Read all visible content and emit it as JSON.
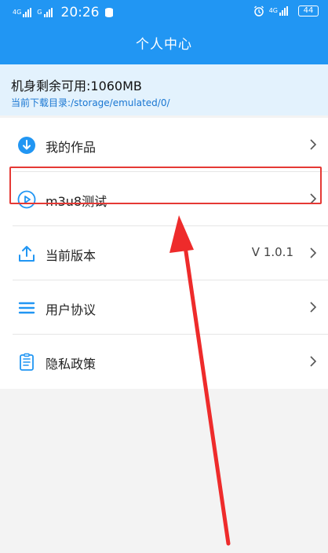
{
  "status_bar": {
    "signal1_label": "4G",
    "signal2_label": "G",
    "time": "20:26",
    "right_network": "4G",
    "battery": "44"
  },
  "header": {
    "title": "个人中心"
  },
  "storage": {
    "free_space": "机身剩余可用:1060MB",
    "download_path": "当前下载目录:/storage/emulated/0/"
  },
  "menu": {
    "items": [
      {
        "label": "我的作品",
        "icon": "download-icon",
        "value": ""
      },
      {
        "label": "m3u8测试",
        "icon": "play-icon",
        "value": ""
      },
      {
        "label": "当前版本",
        "icon": "upload-icon",
        "value": "V 1.0.1"
      },
      {
        "label": "用户协议",
        "icon": "list-icon",
        "value": ""
      },
      {
        "label": "隐私政策",
        "icon": "document-icon",
        "value": ""
      }
    ]
  },
  "colors": {
    "primary": "#2196f3",
    "storage_bg": "#e3f2fd",
    "path_text": "#1976d2",
    "highlight": "#e53935"
  }
}
